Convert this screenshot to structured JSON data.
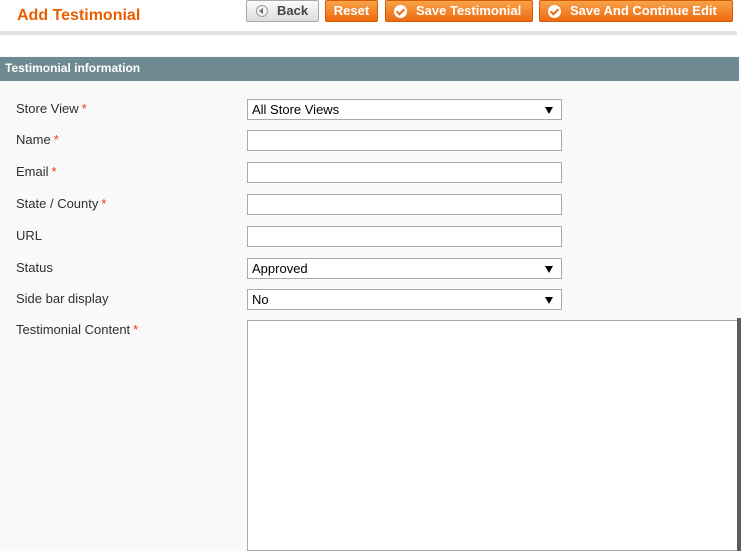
{
  "page": {
    "title": "Add Testimonial"
  },
  "toolbar": {
    "back_label": "Back",
    "reset_label": "Reset",
    "save_label": "Save Testimonial",
    "save_continue_label": "Save And Continue Edit"
  },
  "section": {
    "title": "Testimonial information"
  },
  "form": {
    "required_marker": "*",
    "store_view": {
      "label": "Store View",
      "value": "All Store Views",
      "required": true
    },
    "name": {
      "label": "Name",
      "value": "",
      "required": true
    },
    "email": {
      "label": "Email",
      "value": "",
      "required": true
    },
    "state": {
      "label": "State / County",
      "value": "",
      "required": true
    },
    "url": {
      "label": "URL",
      "value": "",
      "required": false
    },
    "status": {
      "label": "Status",
      "value": "Approved",
      "required": false
    },
    "sidebar_display": {
      "label": "Side bar display",
      "value": "No",
      "required": false
    },
    "content": {
      "label": "Testimonial Content",
      "value": "",
      "required": true
    }
  },
  "icons": {
    "back": "arrow-left-icon",
    "save": "check-circle-icon",
    "dropdown": "dropdown-caret-icon"
  },
  "colors": {
    "title": "#eb5e00",
    "button_orange": "#ee6a10",
    "section_bar": "#6f8992",
    "required": "#eb340a"
  }
}
